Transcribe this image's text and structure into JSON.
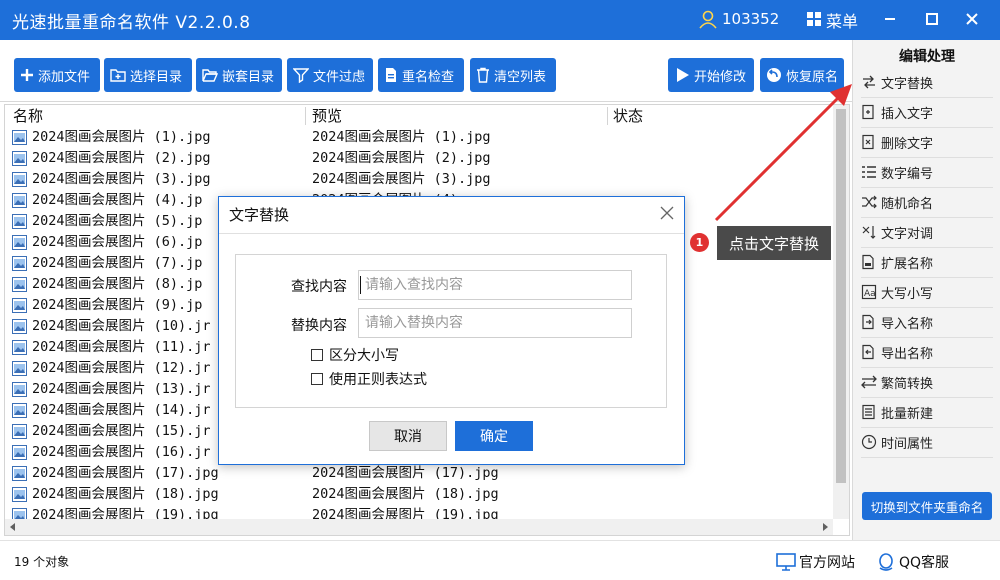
{
  "app": {
    "title": "光速批量重命名软件 V2.2.0.8",
    "user_id": "103352",
    "menu_label": "菜单"
  },
  "toolbar": {
    "add_files": "添加文件",
    "select_dir": "选择目录",
    "nested_dir": "嵌套目录",
    "file_filter": "文件过虑",
    "rename_check": "重名检查",
    "clear_list": "清空列表",
    "start_modify": "开始修改",
    "restore_name": "恢复原名"
  },
  "columns": {
    "name": "名称",
    "preview": "预览",
    "status": "状态"
  },
  "files": [
    {
      "name": "2024图画会展图片 (1).jpg",
      "preview": "2024图画会展图片 (1).jpg"
    },
    {
      "name": "2024图画会展图片 (2).jpg",
      "preview": "2024图画会展图片 (2).jpg"
    },
    {
      "name": "2024图画会展图片 (3).jpg",
      "preview": "2024图画会展图片 (3).jpg"
    },
    {
      "name": "2024图画会展图片 (4).jp",
      "preview": "2024图画会展图片 (4)"
    },
    {
      "name": "2024图画会展图片 (5).jp",
      "preview": ""
    },
    {
      "name": "2024图画会展图片 (6).jp",
      "preview": ""
    },
    {
      "name": "2024图画会展图片 (7).jp",
      "preview": ""
    },
    {
      "name": "2024图画会展图片 (8).jp",
      "preview": ""
    },
    {
      "name": "2024图画会展图片 (9).jp",
      "preview": ""
    },
    {
      "name": "2024图画会展图片 (10).jr",
      "preview": ""
    },
    {
      "name": "2024图画会展图片 (11).jr",
      "preview": ""
    },
    {
      "name": "2024图画会展图片 (12).jr",
      "preview": ""
    },
    {
      "name": "2024图画会展图片 (13).jr",
      "preview": ""
    },
    {
      "name": "2024图画会展图片 (14).jr",
      "preview": ""
    },
    {
      "name": "2024图画会展图片 (15).jr",
      "preview": ""
    },
    {
      "name": "2024图画会展图片 (16).jr",
      "preview": ""
    },
    {
      "name": "2024图画会展图片 (17).jpg",
      "preview": "2024图画会展图片 (17).jpg"
    },
    {
      "name": "2024图画会展图片 (18).jpg",
      "preview": "2024图画会展图片 (18).jpg"
    },
    {
      "name": "2024图画会展图片 (19).jpg",
      "preview": "2024图画会展图片 (19).jpg"
    }
  ],
  "status": {
    "count": "19 个对象"
  },
  "right_panel": {
    "title": "编辑处理",
    "items": [
      {
        "label": "文字替换",
        "icon": "replace-icon"
      },
      {
        "label": "插入文字",
        "icon": "insert-text-icon"
      },
      {
        "label": "删除文字",
        "icon": "delete-text-icon"
      },
      {
        "label": "数字编号",
        "icon": "numbering-icon"
      },
      {
        "label": "随机命名",
        "icon": "shuffle-icon"
      },
      {
        "label": "文字对调",
        "icon": "swap-icon"
      },
      {
        "label": "扩展名称",
        "icon": "extension-icon"
      },
      {
        "label": "大写小写",
        "icon": "case-icon"
      },
      {
        "label": "导入名称",
        "icon": "import-icon"
      },
      {
        "label": "导出名称",
        "icon": "export-icon"
      },
      {
        "label": "繁简转换",
        "icon": "convert-icon"
      },
      {
        "label": "批量新建",
        "icon": "batch-new-icon"
      },
      {
        "label": "时间属性",
        "icon": "clock-icon"
      }
    ],
    "switch_button": "切换到文件夹重命名"
  },
  "dialog": {
    "title": "文字替换",
    "find_label": "查找内容",
    "find_placeholder": "请输入查找内容",
    "replace_label": "替换内容",
    "replace_placeholder": "请输入替换内容",
    "case_sensitive": "区分大小写",
    "use_regex": "使用正则表达式",
    "cancel": "取消",
    "ok": "确定"
  },
  "callout": {
    "number": "1",
    "text": "点击文字替换"
  },
  "footer": {
    "website": "官方网站",
    "qq": "QQ客服"
  },
  "colors": {
    "accent": "#1e6fd9",
    "callout_red": "#e03131",
    "arrow": "#e03131"
  }
}
